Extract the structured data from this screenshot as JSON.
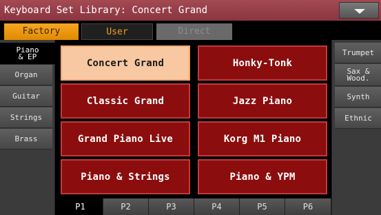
{
  "title": "Keyboard Set Library: Concert Grand",
  "menu_icon": "chevron-down-icon",
  "tabs": {
    "factory": "Factory",
    "user": "User",
    "direct": "Direct"
  },
  "left_tabs": {
    "piano_line1": "Piano",
    "piano_line2": "& EP",
    "organ": "Organ",
    "guitar": "Guitar",
    "strings": "Strings",
    "brass": "Brass"
  },
  "right_tabs": {
    "trumpet": "Trumpet",
    "sax_line1": "Sax &",
    "sax_line2": "Wood.",
    "synth": "Synth",
    "ethnic": "Ethnic"
  },
  "sets": {
    "s1": "Concert Grand",
    "s2": "Honky-Tonk",
    "s3": "Classic Grand",
    "s4": "Jazz Piano",
    "s5": "Grand Piano Live",
    "s6": "Korg M1 Piano",
    "s7": "Piano & Strings",
    "s8": "Piano & YPM"
  },
  "pages": {
    "p1": "P1",
    "p2": "P2",
    "p3": "P3",
    "p4": "P4",
    "p5": "P5",
    "p6": "P6"
  },
  "colors": {
    "title_bar": "#8a3540",
    "selected_set": "#f7c8a2",
    "set_button": "#8c0d0d",
    "factory_tab": "#f5a623"
  }
}
